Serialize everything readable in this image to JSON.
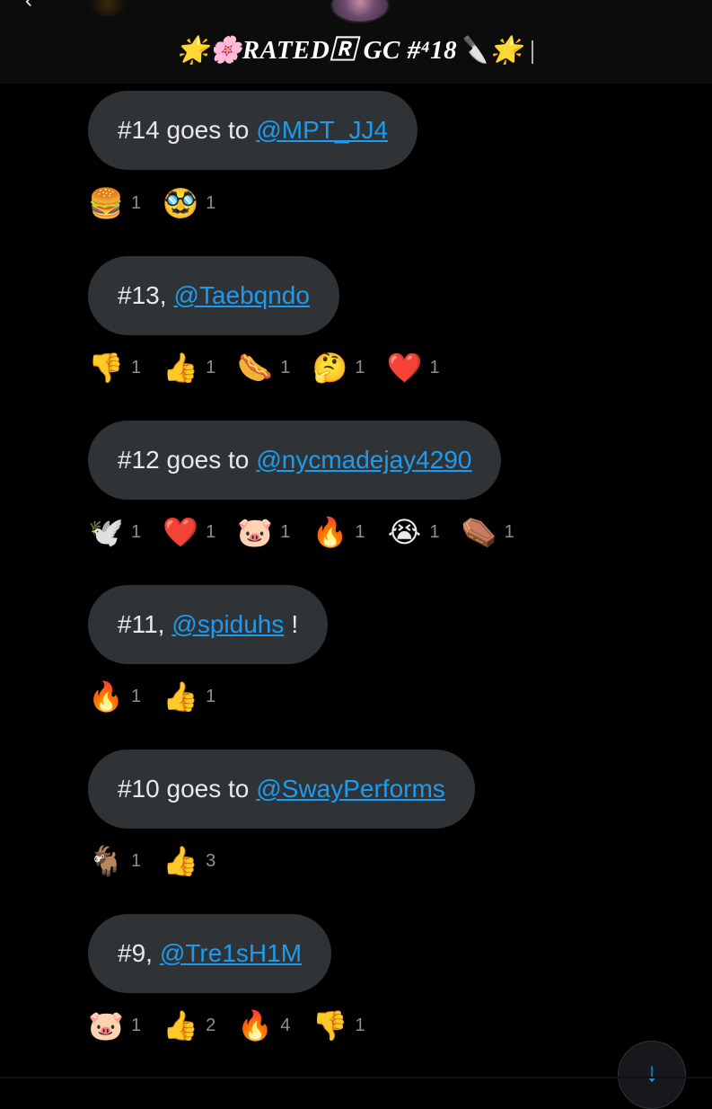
{
  "header": {
    "title": "🌟🌸RATED🅁 GC #⁴18🔪🌟",
    "back_icon": "chevron-left-icon",
    "avatar_icon": "group-avatar"
  },
  "messages": [
    {
      "prefix": "#14 goes to",
      "mention": "@MPT_JJ4",
      "suffix": "",
      "reactions": [
        {
          "emoji": "🍔",
          "count": "1"
        },
        {
          "emoji": "🥸",
          "count": "1"
        }
      ]
    },
    {
      "prefix": "#13,",
      "mention": "@Taebqndo",
      "suffix": "",
      "reactions": [
        {
          "emoji": "👎",
          "count": "1"
        },
        {
          "emoji": "👍",
          "count": "1"
        },
        {
          "emoji": "🌭",
          "count": "1"
        },
        {
          "emoji": "🤔",
          "count": "1"
        },
        {
          "emoji": "❤️",
          "count": "1"
        }
      ]
    },
    {
      "prefix": "#12 goes to",
      "mention": "@nycmadejay4290",
      "suffix": "",
      "reactions": [
        {
          "emoji": "🕊️",
          "count": "1"
        },
        {
          "emoji": "❤️",
          "count": "1"
        },
        {
          "emoji": "🐷",
          "count": "1"
        },
        {
          "emoji": "🔥",
          "count": "1"
        },
        {
          "emoji": "😭",
          "count": "1"
        },
        {
          "emoji": "⚰️",
          "count": "1"
        }
      ]
    },
    {
      "prefix": "#11,",
      "mention": "@spiduhs",
      "suffix": "!",
      "reactions": [
        {
          "emoji": "🔥",
          "count": "1"
        },
        {
          "emoji": "👍",
          "count": "1"
        }
      ]
    },
    {
      "prefix": "#10 goes to",
      "mention": "@SwayPerforms",
      "suffix": "",
      "reactions": [
        {
          "emoji": "🐐",
          "count": "1"
        },
        {
          "emoji": "👍",
          "count": "3"
        }
      ]
    },
    {
      "prefix": "#9,",
      "mention": "@Tre1sH1M",
      "suffix": "",
      "reactions": [
        {
          "emoji": "🐷",
          "count": "1"
        },
        {
          "emoji": "👍",
          "count": "2"
        },
        {
          "emoji": "🔥",
          "count": "4"
        },
        {
          "emoji": "👎",
          "count": "1"
        }
      ]
    }
  ],
  "scroll_button": {
    "icon": "arrow-down-icon",
    "glyph": "↓"
  },
  "colors": {
    "background": "#000000",
    "bubble": "#2f3336",
    "mention": "#1d9bf0",
    "text": "#e7e9ea",
    "count": "#8b8f93"
  }
}
